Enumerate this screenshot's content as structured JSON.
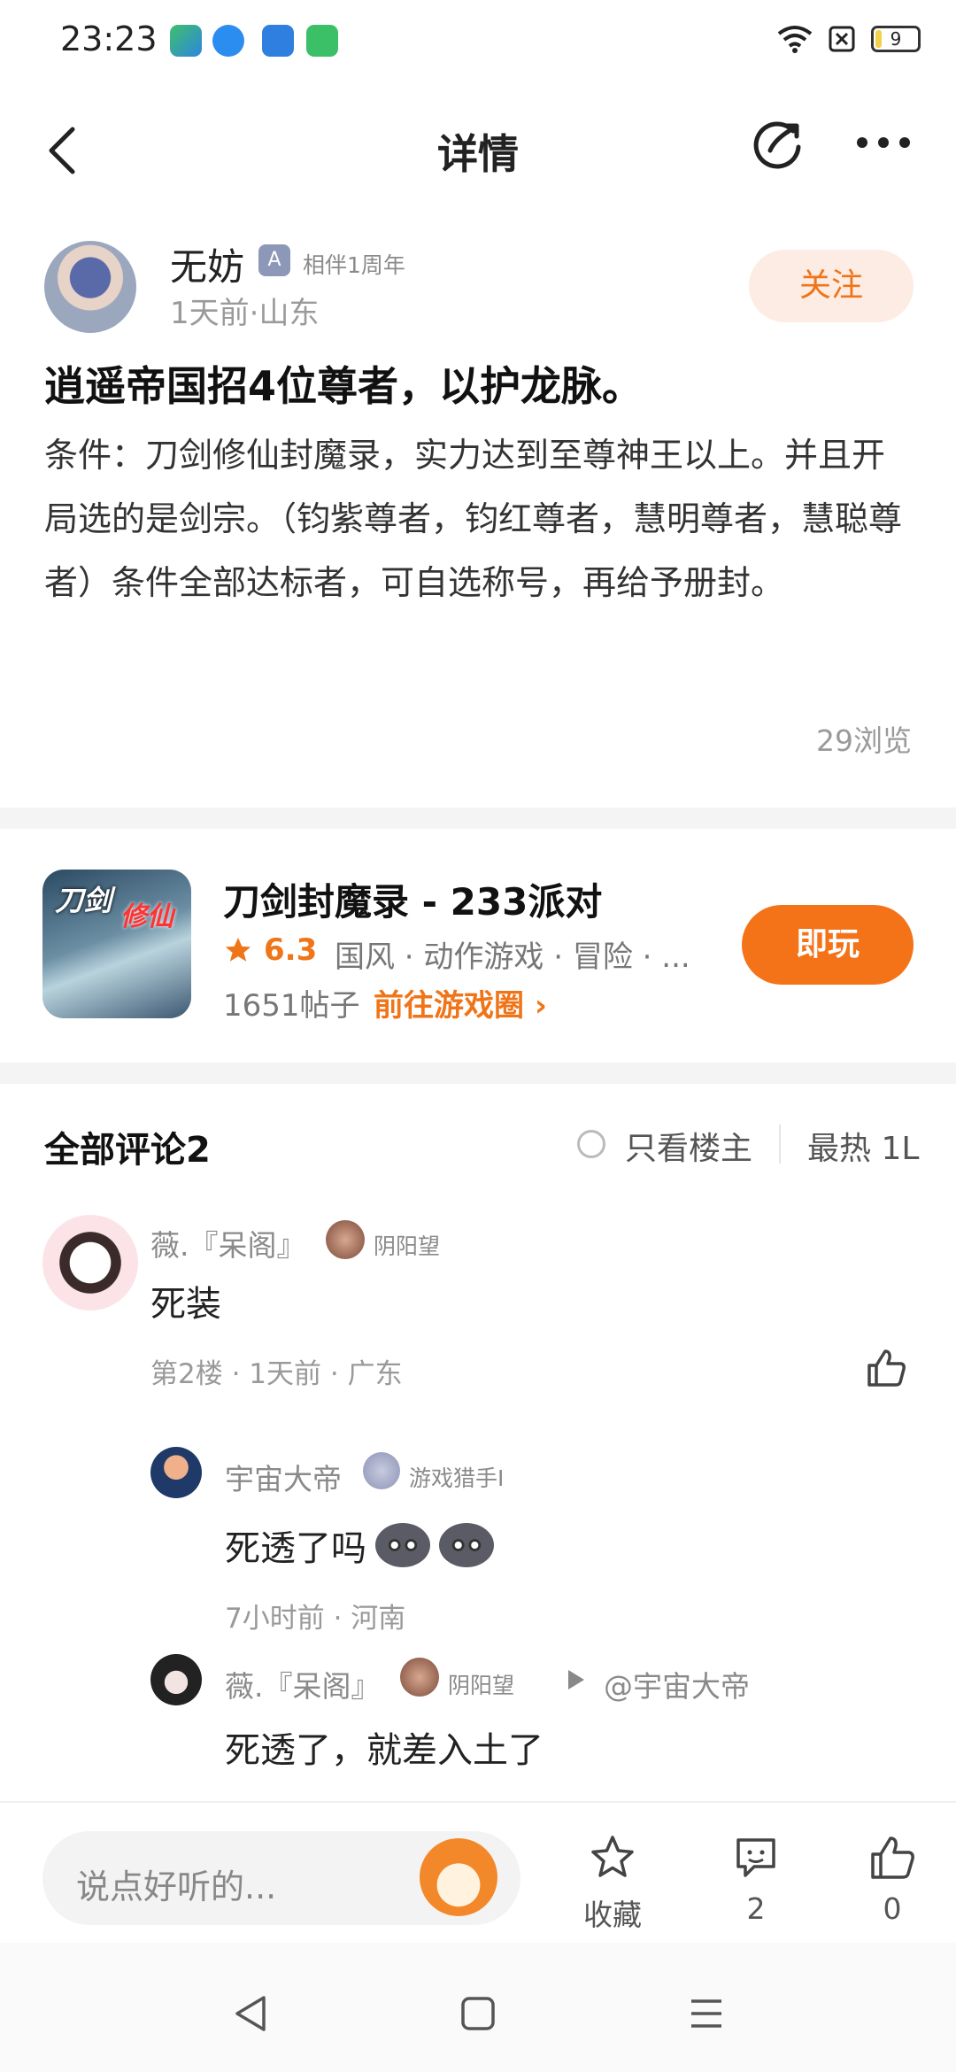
{
  "status_bar": {
    "time": "23:23",
    "battery": "9"
  },
  "header": {
    "title": "详情"
  },
  "author": {
    "name": "无妨",
    "badge": "相伴1周年",
    "meta": "1天前·山东",
    "follow_label": "关注"
  },
  "post": {
    "title": "逍遥帝国招4位尊者，以护龙脉。",
    "body": "条件：刀剑修仙封魔录，实力达到至尊神王以上。并且开局选的是剑宗。（钧紫尊者，钧红尊者，慧明尊者，慧聪尊者）条件全部达标者，可自选称号，再给予册封。",
    "views": "29浏览"
  },
  "game": {
    "icon_text_1": "刀剑",
    "icon_text_2": "修仙",
    "name": "刀剑封魔录 - 233派对",
    "rating": "6.3",
    "tags": "国风 · 动作游戏 · 冒险 · ...",
    "posts": "1651帖子",
    "circle_link": "前往游戏圈 ›",
    "play_label": "即玩"
  },
  "comments": {
    "title": "全部评论2",
    "only_host": "只看楼主",
    "sort": "最热 1L",
    "items": [
      {
        "name": "薇.『呆阁』",
        "badge": "阴阳望",
        "text": "死装",
        "meta": "第2楼 · 1天前 · 广东"
      }
    ],
    "replies": [
      {
        "name": "宇宙大帝",
        "badge": "游戏猎手I",
        "text": "死透了吗",
        "meta": "7小时前 · 河南"
      },
      {
        "name": "薇.『呆阁』",
        "badge": "阴阳望",
        "reply_to": "@宇宙大帝",
        "text": "死透了，就差入土了"
      }
    ]
  },
  "bottom_bar": {
    "placeholder": "说点好听的...",
    "favorite_label": "收藏",
    "comment_count": "2",
    "like_count": "0"
  },
  "colors": {
    "accent": "#f47218",
    "follow_bg": "#fdece4"
  }
}
